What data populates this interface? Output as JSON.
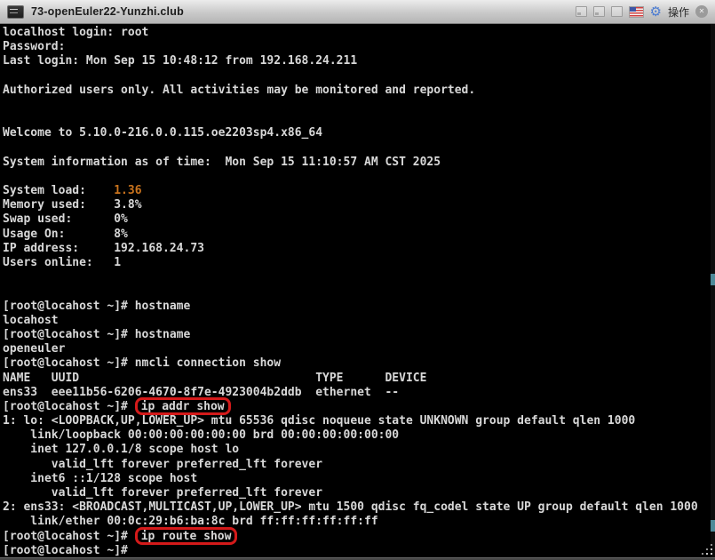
{
  "window": {
    "title": "73-openEuler22-Yunzhi.club",
    "actions_label": "操作",
    "icons": {
      "titlebar_left": "terminal-icon",
      "window_controls": [
        "window-restore-icon",
        "window-cascade-icon",
        "window-maximize-icon"
      ],
      "keyboard_layout": "us-flag-icon",
      "settings": "gear-icon",
      "close": "close-icon",
      "gear_glyph": "⚙",
      "close_glyph": "✕"
    }
  },
  "colors": {
    "highlight_orange": "#c9731d",
    "command_box_red": "#d41a1a",
    "scroll_marker_teal": "#4e8a99",
    "terminal_text": "#d8d8d8",
    "terminal_background": "#000000"
  },
  "terminal": {
    "lines": [
      {
        "segs": [
          {
            "t": "localhost login: root"
          }
        ]
      },
      {
        "segs": [
          {
            "t": "Password:"
          }
        ]
      },
      {
        "segs": [
          {
            "t": "Last login: Mon Sep 15 10:48:12 from 192.168.24.211"
          }
        ]
      },
      {
        "segs": []
      },
      {
        "segs": [
          {
            "t": "Authorized users only. All activities may be monitored and reported."
          }
        ]
      },
      {
        "segs": []
      },
      {
        "segs": []
      },
      {
        "segs": [
          {
            "t": "Welcome to 5.10.0-216.0.0.115.oe2203sp4.x86_64"
          }
        ]
      },
      {
        "segs": []
      },
      {
        "segs": [
          {
            "t": "System information as of time:  Mon Sep 15 11:10:57 AM CST 2025"
          }
        ]
      },
      {
        "segs": []
      },
      {
        "segs": [
          {
            "t": "System load:    "
          },
          {
            "t": "1.36",
            "s": "orange"
          }
        ]
      },
      {
        "segs": [
          {
            "t": "Memory used:    3.8%"
          }
        ]
      },
      {
        "segs": [
          {
            "t": "Swap used:      0%"
          }
        ]
      },
      {
        "segs": [
          {
            "t": "Usage On:       8%"
          }
        ]
      },
      {
        "segs": [
          {
            "t": "IP address:     192.168.24.73"
          }
        ]
      },
      {
        "segs": [
          {
            "t": "Users online:   1"
          }
        ]
      },
      {
        "segs": []
      },
      {
        "segs": []
      },
      {
        "segs": [
          {
            "t": "[root@locahost ~]# hostname"
          }
        ]
      },
      {
        "segs": [
          {
            "t": "locahost"
          }
        ]
      },
      {
        "segs": [
          {
            "t": "[root@locahost ~]# hostname"
          }
        ]
      },
      {
        "segs": [
          {
            "t": "openeuler"
          }
        ]
      },
      {
        "segs": [
          {
            "t": "[root@locahost ~]# nmcli connection show"
          }
        ]
      },
      {
        "segs": [
          {
            "t": "NAME   UUID                                  TYPE      DEVICE"
          }
        ]
      },
      {
        "segs": [
          {
            "t": "ens33  eee11b56-6206-4670-8f7e-4923004b2ddb  ethernet  --"
          }
        ]
      },
      {
        "segs": [
          {
            "t": "[root@locahost ~]# "
          },
          {
            "t": "ip addr show",
            "s": "boxed"
          }
        ]
      },
      {
        "segs": [
          {
            "t": "1: lo: <LOOPBACK,UP,LOWER_UP> mtu 65536 qdisc noqueue state UNKNOWN group default qlen 1000"
          }
        ]
      },
      {
        "segs": [
          {
            "t": "    link/loopback 00:00:00:00:00:00 brd 00:00:00:00:00:00"
          }
        ]
      },
      {
        "segs": [
          {
            "t": "    inet 127.0.0.1/8 scope host lo"
          }
        ]
      },
      {
        "segs": [
          {
            "t": "       valid_lft forever preferred_lft forever"
          }
        ]
      },
      {
        "segs": [
          {
            "t": "    inet6 ::1/128 scope host"
          }
        ]
      },
      {
        "segs": [
          {
            "t": "       valid_lft forever preferred_lft forever"
          }
        ]
      },
      {
        "segs": [
          {
            "t": "2: ens33: <BROADCAST,MULTICAST,UP,LOWER_UP> mtu 1500 qdisc fq_codel state UP group default qlen 1000"
          }
        ]
      },
      {
        "segs": [
          {
            "t": "    link/ether 00:0c:29:b6:ba:8c brd ff:ff:ff:ff:ff:ff"
          }
        ]
      },
      {
        "segs": [
          {
            "t": "[root@locahost ~]# "
          },
          {
            "t": "ip route show",
            "s": "boxed"
          }
        ]
      },
      {
        "segs": [
          {
            "t": "[root@locahost ~]#"
          }
        ]
      }
    ]
  }
}
